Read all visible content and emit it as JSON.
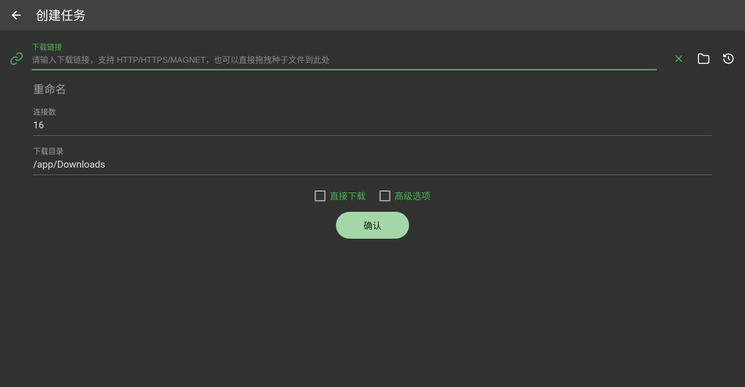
{
  "header": {
    "title": "创建任务"
  },
  "url_section": {
    "label": "下载链接",
    "placeholder": "请输入下载链接，支持 HTTP/HTTPS/MAGNET，也可以直接拖拽种子文件到此处",
    "value": ""
  },
  "rename": {
    "label": "重命名"
  },
  "connections": {
    "label": "连接数",
    "value": "16"
  },
  "download_dir": {
    "label": "下载目录",
    "value": "/app/Downloads"
  },
  "checkboxes": {
    "direct_download": "直接下载",
    "advanced_options": "高级选项"
  },
  "confirm_button": "确认",
  "colors": {
    "accent": "#4caf50",
    "button_bg": "#a5d6a7"
  }
}
